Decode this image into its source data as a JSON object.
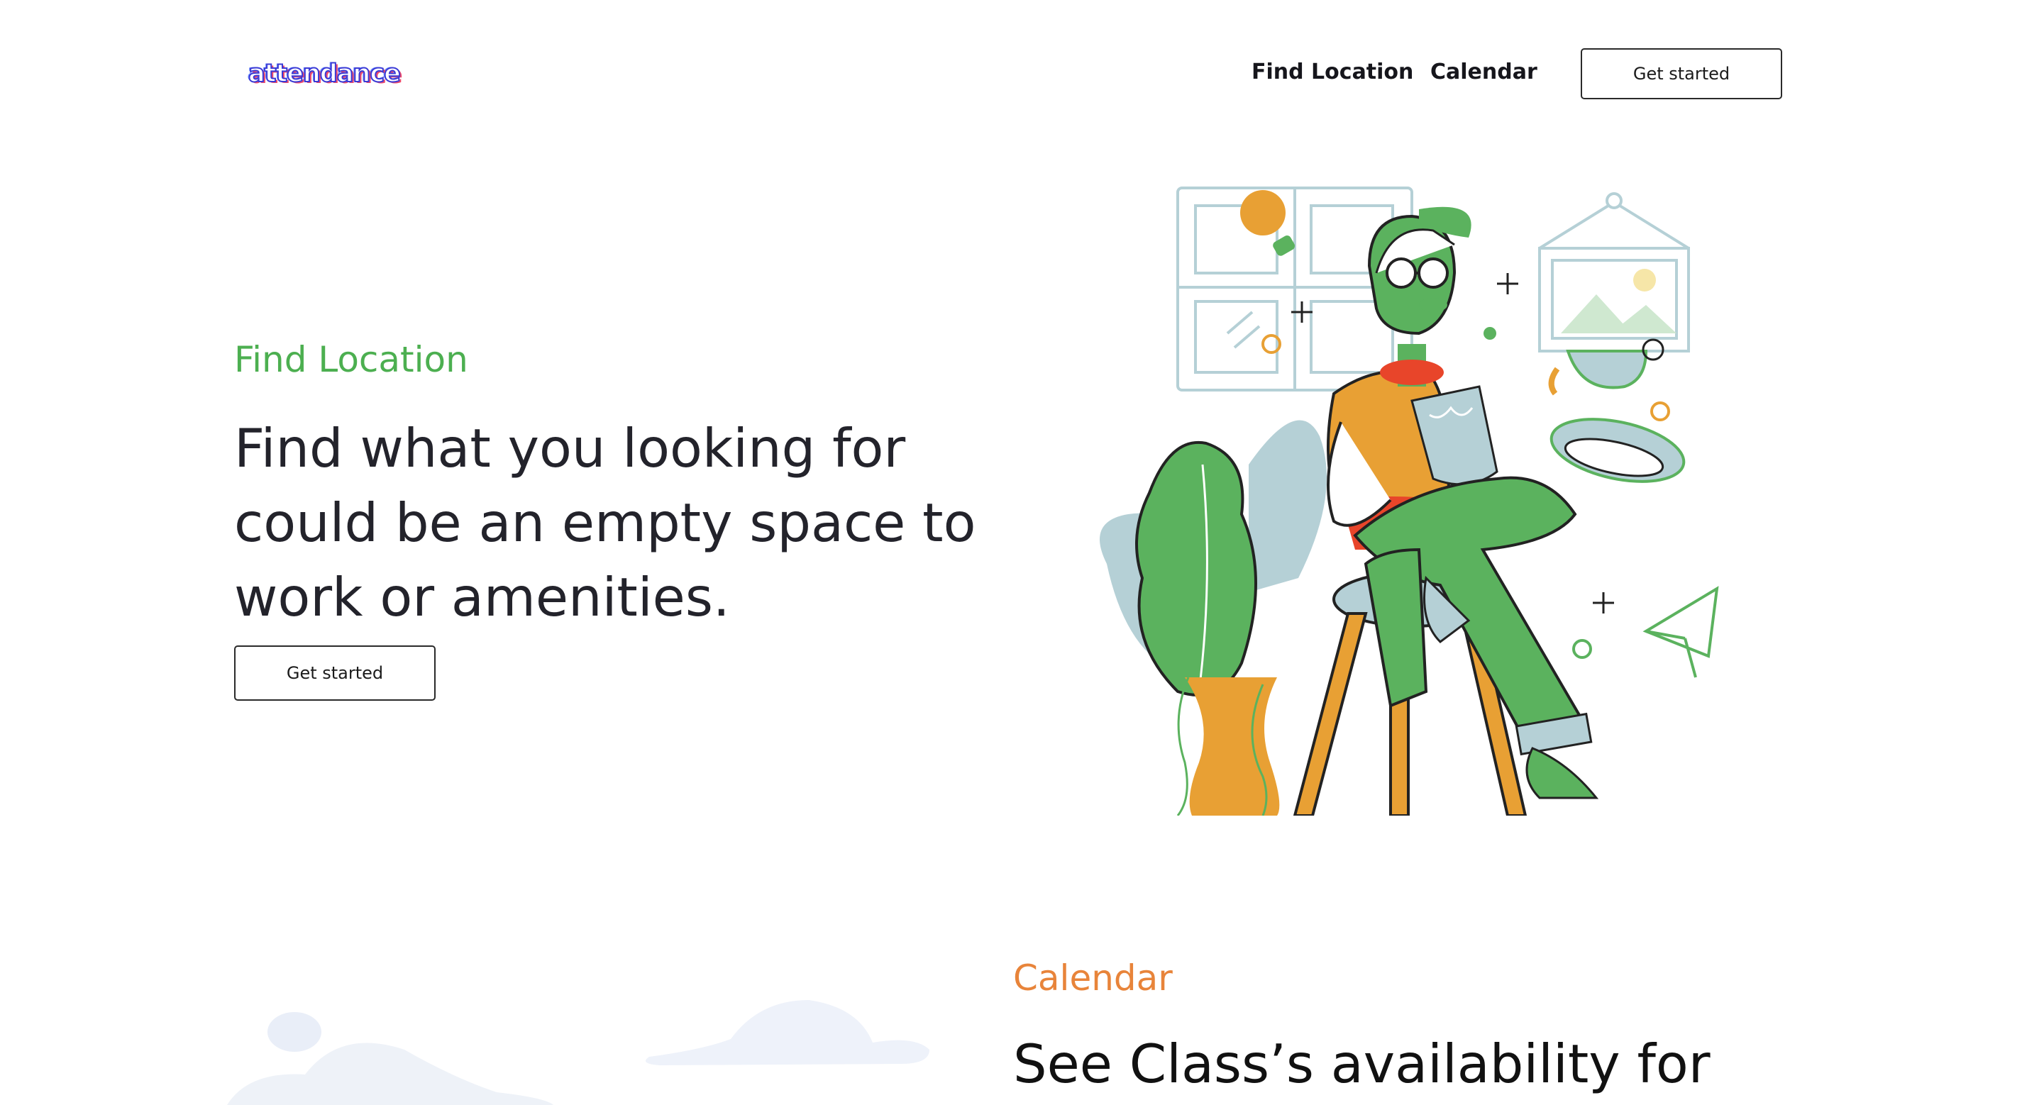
{
  "header": {
    "logo_text": "attendance",
    "nav": [
      {
        "label": "Find Location"
      },
      {
        "label": "Calendar"
      }
    ],
    "cta_label": "Get started"
  },
  "hero": {
    "eyebrow": "Find Location",
    "headline_lines": [
      "Find what you looking for",
      "could be an empty space to",
      "work or amenities."
    ],
    "cta_label": "Get started",
    "illustration": "person-reading-on-stool-illustration"
  },
  "calendar_section": {
    "eyebrow": "Calendar",
    "headline": "See Class’s availability for"
  },
  "colors": {
    "green": "#4caf50",
    "orange": "#e8843a",
    "dark_text": "#23232b",
    "illustration_green": "#5bb25e",
    "illustration_orange": "#e8a034",
    "illustration_blue": "#b5d0d6"
  }
}
